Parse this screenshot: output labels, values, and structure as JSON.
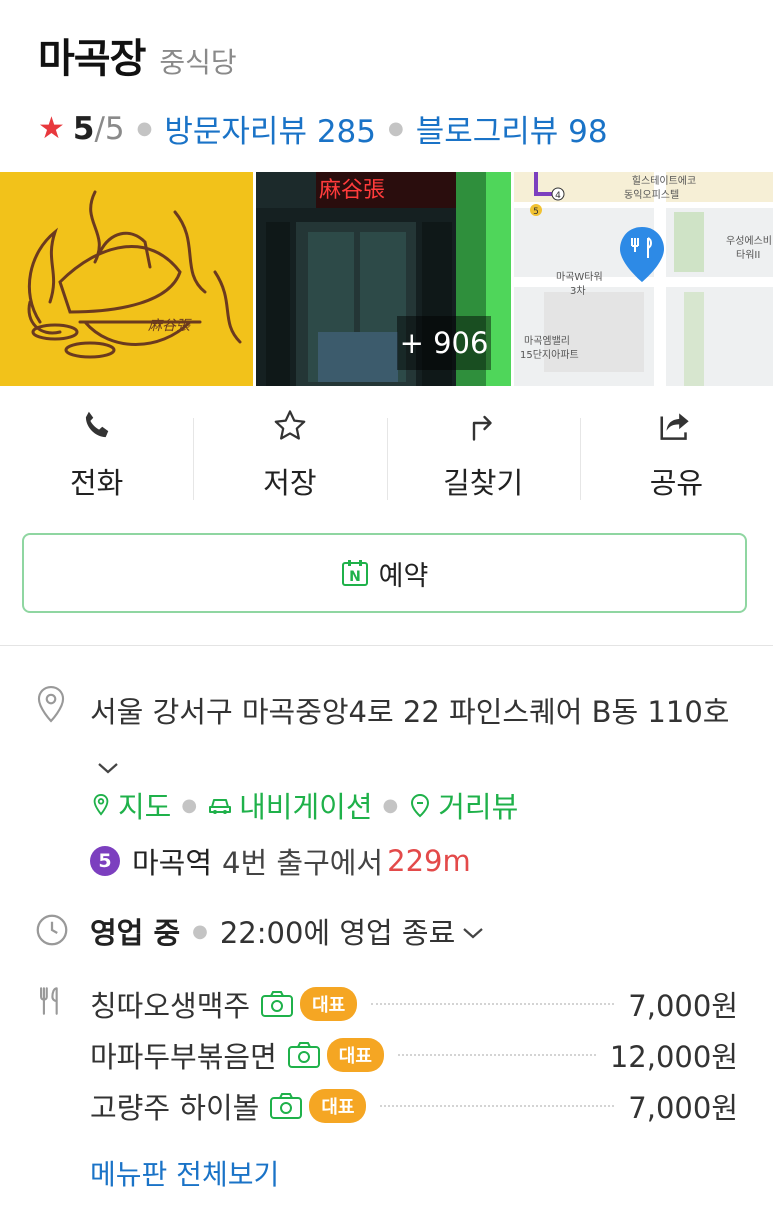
{
  "place": {
    "name": "마곡장",
    "category": "중식당"
  },
  "rating": {
    "star": "★",
    "value": "5",
    "max": "/5"
  },
  "reviews": {
    "visitor": "방문자리뷰 285",
    "blog": "블로그리뷰 98"
  },
  "photos": {
    "more_count": "+ 906",
    "sign_text": "麻谷張",
    "logo_text": "麻谷張",
    "map_labels": {
      "building_1": "힐스테이트에코",
      "building_1b": "동익오피스텔",
      "tower": "마곡W타워",
      "tower_b": "3차",
      "apartment": "마곡엠밸리",
      "apartment_b": "15단지아파트",
      "right_building": "우성에스비",
      "right_building_b": "타워II",
      "line_5": "5",
      "line_4": "4"
    }
  },
  "actions": [
    {
      "label": "전화",
      "icon": "phone-icon"
    },
    {
      "label": "저장",
      "icon": "star-icon"
    },
    {
      "label": "길찾기",
      "icon": "directions-icon"
    },
    {
      "label": "공유",
      "icon": "share-icon"
    }
  ],
  "reserve": {
    "label": "예약",
    "icon_letter": "N"
  },
  "address": {
    "text": "서울 강서구 마곡중앙4로 22 파인스퀘어 B동 110호"
  },
  "links": {
    "map": "지도",
    "navigation": "내비게이션",
    "street_view": "거리뷰"
  },
  "subway": {
    "line": "5",
    "station": "마곡역",
    "exit": "4번 출구에서",
    "distance": "229m"
  },
  "hours": {
    "status": "영업 중",
    "detail": "22:00에 영업 종료"
  },
  "menu": {
    "items": [
      {
        "name": "칭따오생맥주",
        "badge": "대표",
        "price": "7,000원"
      },
      {
        "name": "마파두부볶음면",
        "badge": "대표",
        "price": "12,000원"
      },
      {
        "name": "고량주 하이볼",
        "badge": "대표",
        "price": "7,000원"
      }
    ],
    "view_all": "메뉴판 전체보기"
  },
  "colors": {
    "accent_green": "#1fb14a",
    "link_blue": "#1a73c7",
    "star_red": "#e8383d",
    "badge_orange": "#f5a623",
    "line5_purple": "#7c3fbf"
  }
}
